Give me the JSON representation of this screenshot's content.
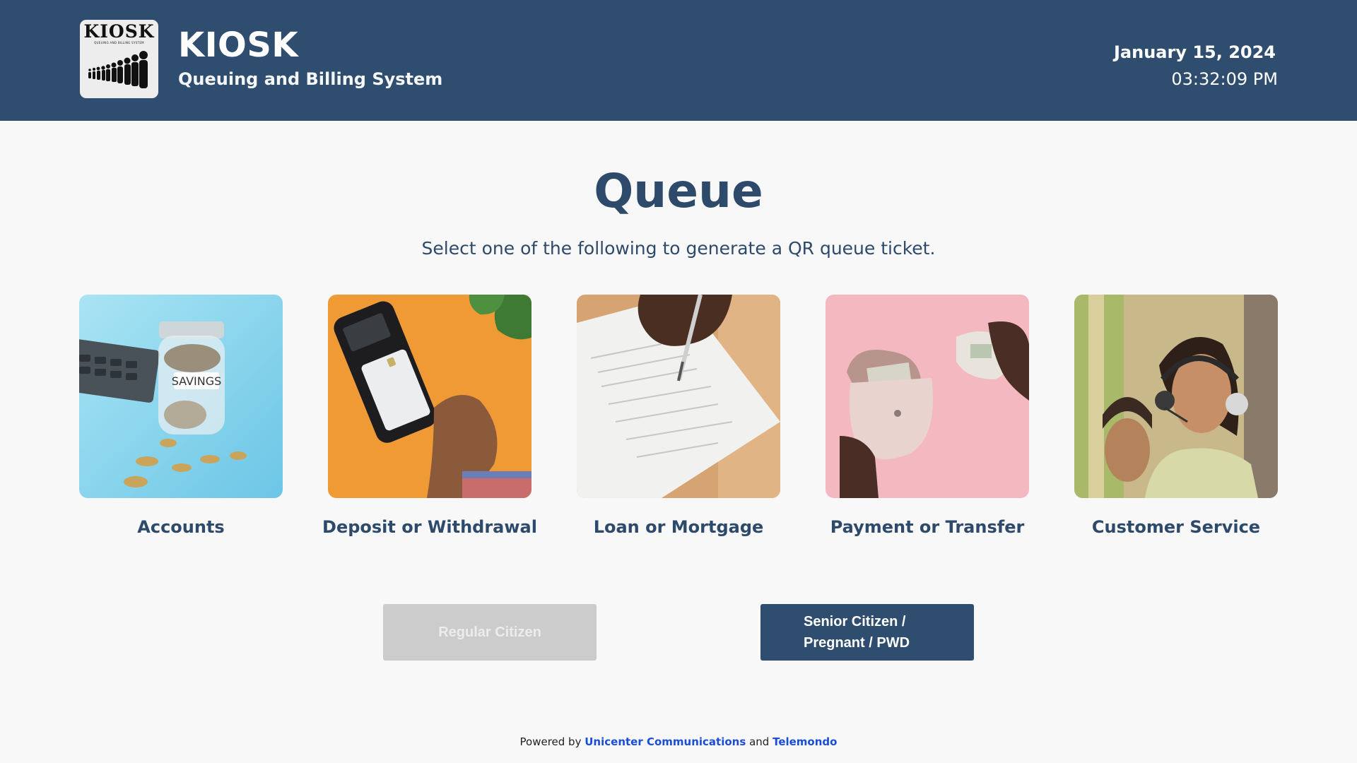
{
  "header": {
    "logo_text": "KIOSK",
    "logo_subtext": "QUEUING AND BILLING SYSTEM",
    "title": "KIOSK",
    "subtitle": "Queuing and Billing System",
    "date": "January 15, 2024",
    "time": "03:32:09 PM"
  },
  "main": {
    "title": "Queue",
    "subtitle": "Select one of the following to generate a QR queue ticket.",
    "services": [
      {
        "label": "Accounts",
        "image": "savings-jar-image"
      },
      {
        "label": "Deposit or Withdrawal",
        "image": "card-terminal-image"
      },
      {
        "label": "Loan or Mortgage",
        "image": "signing-document-image"
      },
      {
        "label": "Payment or Transfer",
        "image": "wallet-cash-image"
      },
      {
        "label": "Customer Service",
        "image": "call-center-agent-image"
      }
    ],
    "jar_label": "SAVINGS",
    "buttons": {
      "regular": "Regular Citizen",
      "senior_line1": "Senior Citizen /",
      "senior_line2": "Pregnant / PWD"
    }
  },
  "footer": {
    "prefix": "Powered by",
    "link1": "Unicenter Communications",
    "middle": "and",
    "link2": "Telemondo"
  },
  "colors": {
    "header_bg": "#2f4e6f",
    "text_primary": "#2e4a6b",
    "button_disabled": "#cccccc",
    "link": "#1b4ed8"
  }
}
